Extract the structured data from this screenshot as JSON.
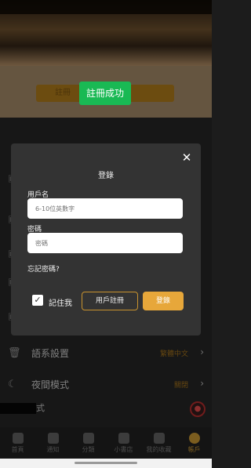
{
  "toast": {
    "text": "註冊成功"
  },
  "header": {
    "button_label": "註冊"
  },
  "login_modal": {
    "title": "登錄",
    "close_glyph": "✕",
    "username": {
      "label": "用戶名",
      "placeholder": "6-10位英數字",
      "value": ""
    },
    "password": {
      "label": "密碼",
      "placeholder": "密碼",
      "value": ""
    },
    "forgot_label": "忘記密碼?",
    "remember": {
      "label": "記住我",
      "checked": true,
      "glyph": "✓"
    },
    "register_button": "用戶註冊",
    "login_button": "登錄"
  },
  "settings": {
    "rows": [
      {
        "icon": "trash-icon",
        "glyph": "🗑",
        "label": "語系設置",
        "value": "繁體中文",
        "arrow": "›"
      },
      {
        "icon": "moon-icon",
        "glyph": "☾",
        "label": "夜間模式",
        "value": "關閉",
        "arrow": "›"
      }
    ],
    "partial_row_label": "式"
  },
  "tabbar": {
    "tabs": [
      {
        "label": "首頁",
        "icon": "home-icon",
        "active": false
      },
      {
        "label": "通知",
        "icon": "bell-icon",
        "active": false
      },
      {
        "label": "分類",
        "icon": "category-icon",
        "active": false
      },
      {
        "label": "小書店",
        "icon": "store-icon",
        "active": false
      },
      {
        "label": "我的收藏",
        "icon": "heart-icon",
        "active": false
      },
      {
        "label": "帳戶",
        "icon": "user-icon",
        "active": true
      }
    ]
  },
  "colors": {
    "accent": "#e7a73a",
    "toast": "#19b954",
    "modal_bg": "#333333"
  }
}
